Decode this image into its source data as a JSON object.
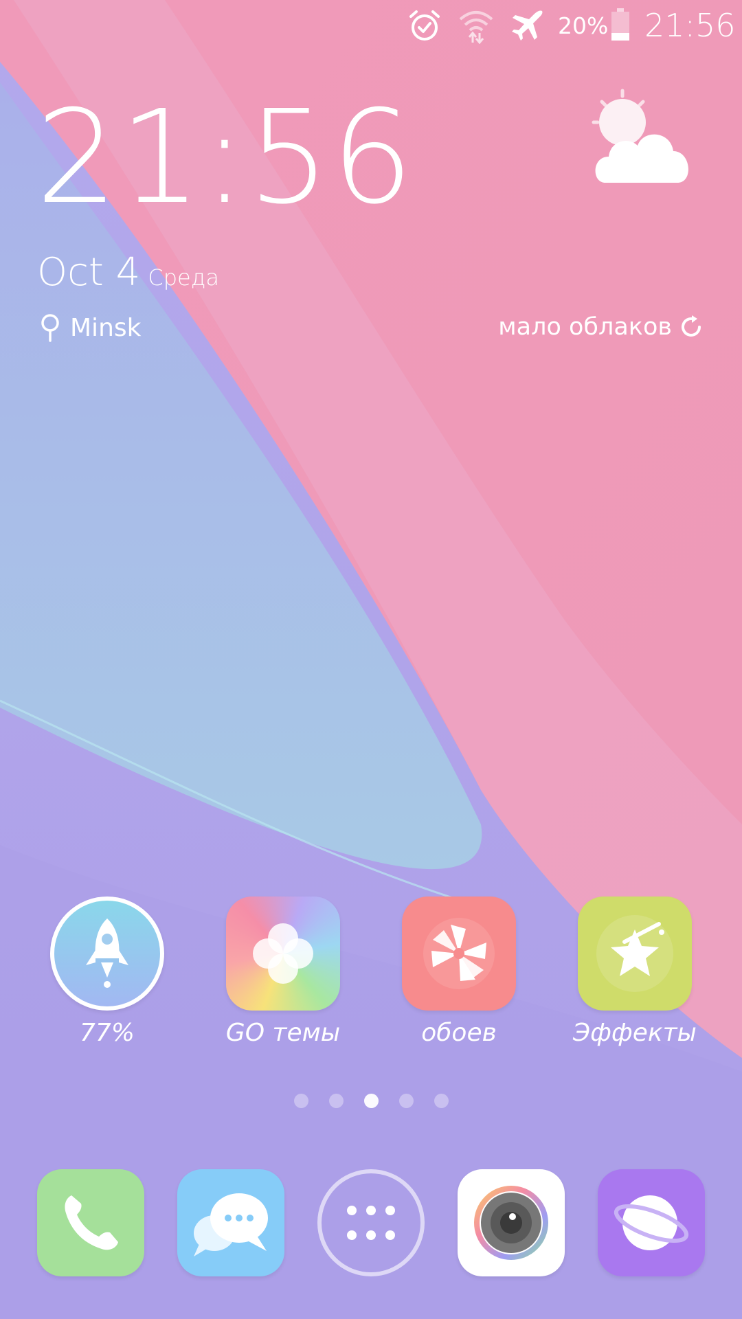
{
  "status_bar": {
    "battery_percent": "20%",
    "time": "21:56",
    "icons": [
      "alarm-icon",
      "wifi-icon",
      "airplane-mode-icon",
      "battery-icon"
    ]
  },
  "clock_widget": {
    "time": "21:56",
    "date": "Oct 4",
    "weekday": "Среда",
    "location": "Minsk",
    "weather_description": "мало облаков",
    "weather_icon": "partly-cloudy-icon"
  },
  "apps": [
    {
      "label": "77%",
      "icon": "rocket-booster-icon",
      "color": "#86d2ea"
    },
    {
      "label": "GO темы",
      "icon": "flower-icon",
      "color": "#f7a9a6"
    },
    {
      "label": "обоев",
      "icon": "pinwheel-icon",
      "color": "#f88c8c"
    },
    {
      "label": "Эффекты",
      "icon": "magic-star-icon",
      "color": "#cfdc6a"
    }
  ],
  "pages": {
    "count": 5,
    "active": 3
  },
  "dock": [
    {
      "icon": "phone-icon",
      "color": "#a5e09a"
    },
    {
      "icon": "messages-icon",
      "color": "#86ccf8"
    },
    {
      "icon": "app-drawer-icon",
      "color": "transparent"
    },
    {
      "icon": "camera-icon",
      "color": "#ffffff"
    },
    {
      "icon": "browser-icon",
      "color": "#a978ef"
    }
  ]
}
